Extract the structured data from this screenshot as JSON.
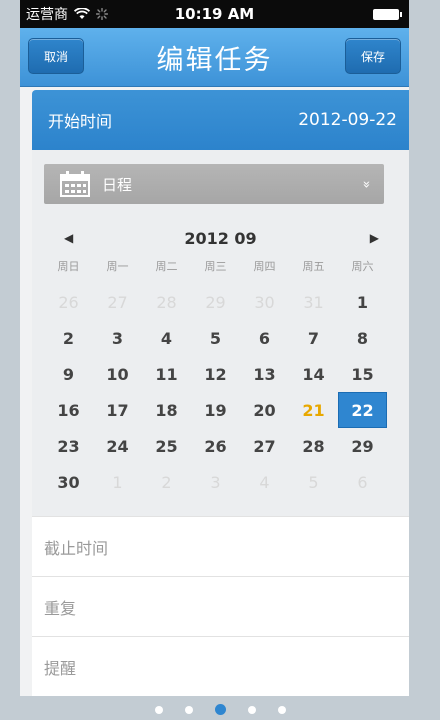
{
  "status_bar": {
    "carrier": "运营商",
    "time": "10:19 AM"
  },
  "nav": {
    "cancel_label": "取消",
    "title": "编辑任务",
    "save_label": "保存"
  },
  "start_time": {
    "label": "开始时间",
    "value": "2012-09-22"
  },
  "schedule": {
    "label": "日程",
    "icon": "calendar-icon",
    "chevron": "»"
  },
  "calendar": {
    "month_label": "2012 09",
    "prev_arrow": "◀",
    "next_arrow": "▶",
    "weekdays": [
      "周日",
      "周一",
      "周二",
      "周三",
      "周四",
      "周五",
      "周六"
    ],
    "days": [
      {
        "d": "26",
        "muted": true
      },
      {
        "d": "27",
        "muted": true
      },
      {
        "d": "28",
        "muted": true
      },
      {
        "d": "29",
        "muted": true
      },
      {
        "d": "30",
        "muted": true
      },
      {
        "d": "31",
        "muted": true
      },
      {
        "d": "1"
      },
      {
        "d": "2"
      },
      {
        "d": "3"
      },
      {
        "d": "4"
      },
      {
        "d": "5"
      },
      {
        "d": "6"
      },
      {
        "d": "7"
      },
      {
        "d": "8"
      },
      {
        "d": "9"
      },
      {
        "d": "10"
      },
      {
        "d": "11"
      },
      {
        "d": "12"
      },
      {
        "d": "13"
      },
      {
        "d": "14"
      },
      {
        "d": "15"
      },
      {
        "d": "16"
      },
      {
        "d": "17"
      },
      {
        "d": "18"
      },
      {
        "d": "19"
      },
      {
        "d": "20"
      },
      {
        "d": "21",
        "today": true
      },
      {
        "d": "22",
        "selected": true
      },
      {
        "d": "23"
      },
      {
        "d": "24"
      },
      {
        "d": "25"
      },
      {
        "d": "26"
      },
      {
        "d": "27"
      },
      {
        "d": "28"
      },
      {
        "d": "29"
      },
      {
        "d": "30"
      },
      {
        "d": "1",
        "muted": true
      },
      {
        "d": "2",
        "muted": true
      },
      {
        "d": "3",
        "muted": true
      },
      {
        "d": "4",
        "muted": true
      },
      {
        "d": "5",
        "muted": true
      },
      {
        "d": "6",
        "muted": true
      }
    ],
    "today_color": "#e8a800",
    "selected_color": "#2f86d0"
  },
  "options": [
    {
      "label": "截止时间"
    },
    {
      "label": "重复"
    },
    {
      "label": "提醒"
    }
  ],
  "page_indicator": {
    "count": 5,
    "active_index": 2
  },
  "colors": {
    "accent": "#3d92d7",
    "background": "#c3ccd3"
  }
}
